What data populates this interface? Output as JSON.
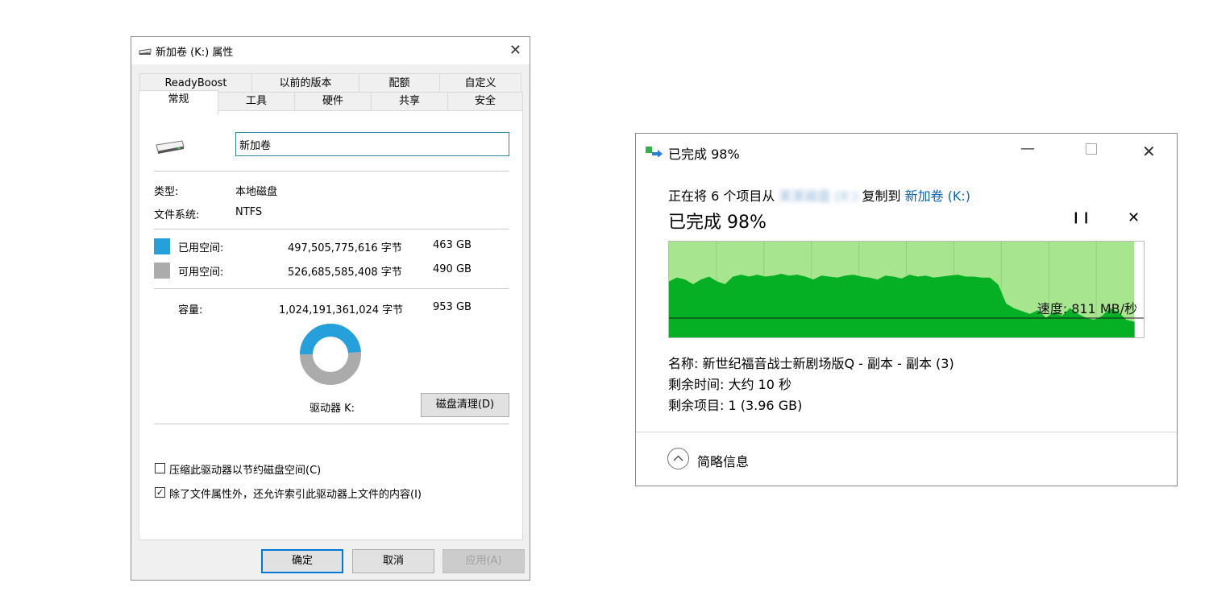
{
  "properties": {
    "title": "新加卷 (K:) 属性",
    "tabs_back": [
      "ReadyBoost",
      "以前的版本",
      "配额",
      "自定义"
    ],
    "tabs_front": [
      "常规",
      "工具",
      "硬件",
      "共享",
      "安全"
    ],
    "selected_tab": "常规",
    "volume_name": "新加卷",
    "type_label": "类型:",
    "type_value": "本地磁盘",
    "fs_label": "文件系统:",
    "fs_value": "NTFS",
    "used_label": "已用空间:",
    "used_bytes": "497,505,775,616 字节",
    "used_gb": "463 GB",
    "free_label": "可用空间:",
    "free_bytes": "526,685,585,408 字节",
    "free_gb": "490 GB",
    "cap_label": "容量:",
    "cap_bytes": "1,024,191,361,024 字节",
    "cap_gb": "953 GB",
    "drive_label": "驱动器 K:",
    "cleanup_button": "磁盘清理(D)",
    "compress_label": "压缩此驱动器以节约磁盘空间(C)",
    "compress_checked": false,
    "index_label": "除了文件属性外，还允许索引此驱动器上文件的内容(I)",
    "index_checked": true,
    "ok": "确定",
    "cancel": "取消",
    "apply": "应用(A)",
    "used_fraction": 0.4858,
    "colors": {
      "used": "#26a0da",
      "free": "#ababab"
    }
  },
  "copy": {
    "title": "已完成 98%",
    "line_prefix": "正在将 6 个项目从",
    "line_source": "某某磁盘 (X:)",
    "line_mid": "复制到",
    "line_dest": "新加卷 (K:)",
    "progress_title": "已完成 98%",
    "progress_percent": 98,
    "speed_label": "速度: 811 MB/秒",
    "name_line": "名称: 新世纪福音战士新剧场版Q - 副本 - 副本 (3)",
    "time_line": "剩余时间: 大约 10 秒",
    "items_line": "剩余项目: 1 (3.96 GB)",
    "details_toggle": "简略信息",
    "colors": {
      "done_bg": "#a8e58f",
      "speed_fill": "#06b025"
    }
  }
}
